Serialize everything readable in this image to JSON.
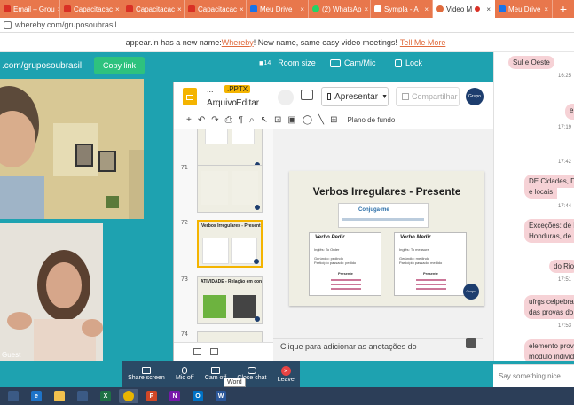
{
  "browser": {
    "tabs": [
      {
        "label": "Email – Grou",
        "color": "#d93025"
      },
      {
        "label": "Capacitacac",
        "color": "#d93025"
      },
      {
        "label": "Capacitacac",
        "color": "#d93025"
      },
      {
        "label": "Capacitacac",
        "color": "#d93025"
      },
      {
        "label": "Meu Drive",
        "color": "#1a73e8"
      },
      {
        "label": "(2) WhatsAp",
        "color": "#25d366"
      },
      {
        "label": "Sympla - A",
        "color": "#e8774c"
      },
      {
        "label": "Video M",
        "color": "#e06b3d"
      },
      {
        "label": "Meu Drive",
        "color": "#1a73e8"
      }
    ],
    "new_tab_icon": "+",
    "url": "whereby.com/gruposoubrasil"
  },
  "notice": {
    "prefix": "appear.in has a new name: ",
    "link1": "Whereby",
    "middle": "! New name, same easy video meetings!",
    "link2": "Tell Me More"
  },
  "room": {
    "url": ".com/gruposoubrasil",
    "copy_link": "Copy link",
    "room_size": "Room size",
    "room_size_badge": "14",
    "cam_mic": "Cam/Mic",
    "lock": "Lock",
    "guest_label": "Guest"
  },
  "slides": {
    "file_title": "...",
    "pptx_badge": ".PPTX",
    "menu": [
      "Arquivo",
      "Editar"
    ],
    "present": "Apresentar",
    "share": "Compartilhar",
    "avatar_text": "Grupo SouBrasil",
    "toolbar_bg_label": "Plano de fundo",
    "thumbnails": [
      {
        "num": "",
        "title": ""
      },
      {
        "num": "71",
        "title": ""
      },
      {
        "num": "72",
        "title": "Verbos Irregulares - Presente"
      },
      {
        "num": "73",
        "title": "ATIVIDADE - Relação em conjunto"
      },
      {
        "num": "74",
        "title": ""
      }
    ],
    "current_slide": {
      "title": "Verbos Irregulares - Presente",
      "logo_text": "Conjuga-me",
      "cards": [
        {
          "title": "Verbo Pedir...",
          "lines": [
            "Inglês: To Order",
            "Gerúndio: pedindo",
            "Particípio passado: pedido"
          ],
          "subhead": "Presente"
        },
        {
          "title": "Verbo Medir...",
          "lines": [
            "Inglês: To measure",
            "Gerúndio: medindo",
            "Particípio passado: medido"
          ],
          "subhead": "Presente"
        }
      ],
      "badge": "Grupo SouBrasil"
    },
    "notes_placeholder": "Clique para adicionar as anotações do"
  },
  "chat": {
    "messages": [
      {
        "text": "Sul e Oeste",
        "time": "16:25"
      },
      {
        "text": "e",
        "time": "17:19"
      },
      {
        "text": "",
        "time": "17:42"
      },
      {
        "text": "DE Cidades, DA",
        "time": ""
      },
      {
        "text": "e locais",
        "time": "17:44"
      },
      {
        "text": "Exceções: de Po",
        "time": ""
      },
      {
        "text": "Honduras, de Is",
        "time": ""
      },
      {
        "text": "do Rio",
        "time": "17:51"
      },
      {
        "text": "ufrgs celpebras",
        "time": ""
      },
      {
        "text": "das provas do e",
        "time": "17:53"
      },
      {
        "text": "elemento provo",
        "time": ""
      },
      {
        "text": "módulo individ",
        "time": ""
      }
    ],
    "input_placeholder": "Say something nice"
  },
  "controls": {
    "share_screen": "Share screen",
    "mic_off": "Mic off",
    "cam_off": "Cam off",
    "close_chat": "Close chat",
    "leave": "Leave",
    "tooltip": "Word"
  },
  "taskbar": {
    "apps": [
      {
        "name": "taskview",
        "color": "#3b5a85",
        "label": ""
      },
      {
        "name": "edge",
        "color": "#1e73c8",
        "label": "e"
      },
      {
        "name": "explorer",
        "color": "#f2c14e",
        "label": ""
      },
      {
        "name": "store",
        "color": "#3b5a85",
        "label": ""
      },
      {
        "name": "excel",
        "color": "#1e7145",
        "label": "X"
      },
      {
        "name": "chrome",
        "color": "#e9b500",
        "label": ""
      },
      {
        "name": "powerpoint",
        "color": "#d24726",
        "label": "P"
      },
      {
        "name": "onenote",
        "color": "#7719aa",
        "label": "N"
      },
      {
        "name": "outlook",
        "color": "#0072c6",
        "label": "O"
      },
      {
        "name": "word",
        "color": "#2b579a",
        "label": "W"
      }
    ]
  }
}
